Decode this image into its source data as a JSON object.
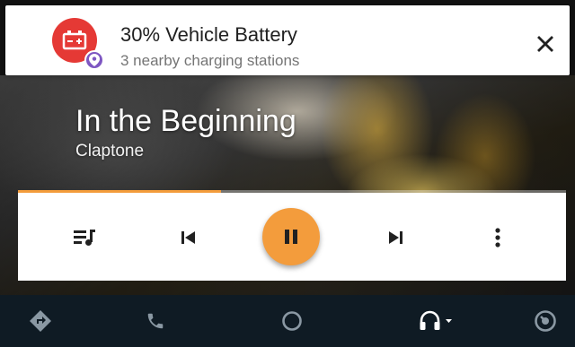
{
  "notification": {
    "title": "30% Vehicle Battery",
    "subtitle": "3 nearby charging stations",
    "battery_icon": "battery-alert-icon",
    "battery_color": "#e53935",
    "pin_icon": "location-pin-icon",
    "pin_color": "#7e57c2",
    "close_icon": "close-icon"
  },
  "now_playing": {
    "title": "In the Beginning",
    "artist": "Claptone",
    "progress": 0.37,
    "accent_color": "#f39c3c"
  },
  "controls": {
    "queue_icon": "queue-music-icon",
    "previous_icon": "skip-previous-icon",
    "playpause_icon": "pause-icon",
    "next_icon": "skip-next-icon",
    "more_icon": "more-vert-icon"
  },
  "nav": {
    "items": [
      {
        "icon": "navigation-icon"
      },
      {
        "icon": "phone-icon"
      },
      {
        "icon": "home-icon"
      },
      {
        "icon": "headphones-icon"
      },
      {
        "icon": "exit-icon"
      }
    ]
  }
}
